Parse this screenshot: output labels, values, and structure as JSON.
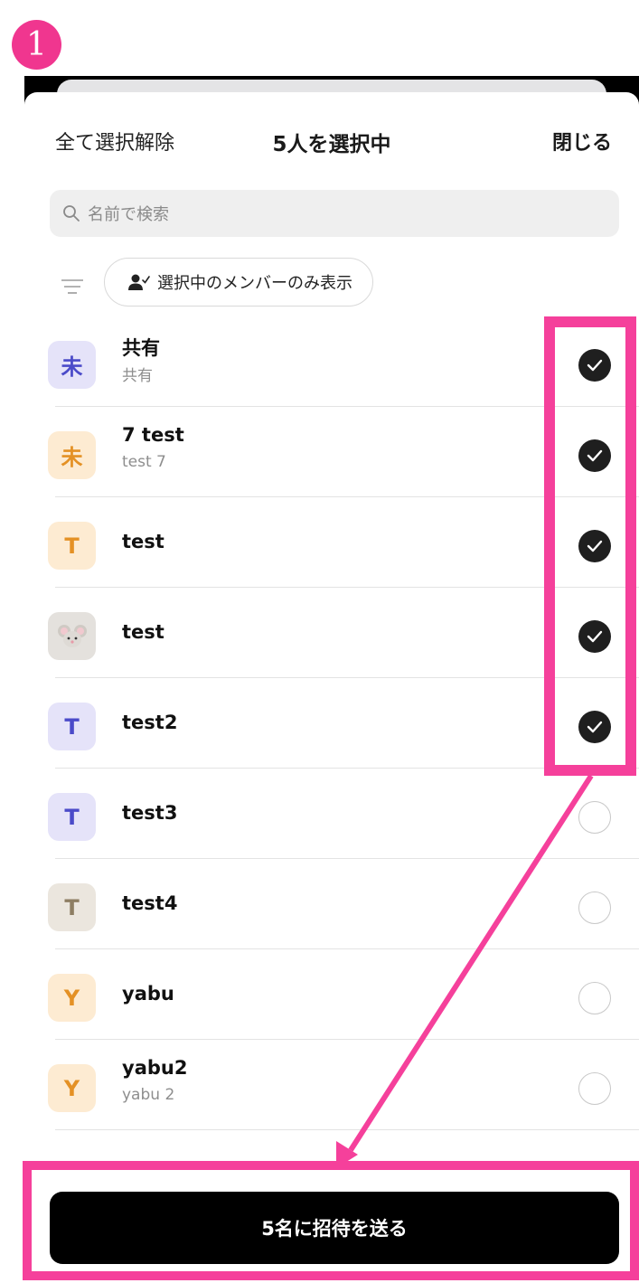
{
  "step_number": "1",
  "header": {
    "deselect_all": "全て選択解除",
    "title": "5人を選択中",
    "close": "閉じる"
  },
  "search": {
    "placeholder": "名前で検索"
  },
  "filter": {
    "chip_label": "選択中のメンバーのみ表示"
  },
  "members": [
    {
      "avatar": "未",
      "avatar_bg": "#e5e3f9",
      "avatar_fg": "#4b4bc9",
      "name": "共有",
      "sub": "共有",
      "selected": true
    },
    {
      "avatar": "未",
      "avatar_bg": "#fdebd2",
      "avatar_fg": "#e49125",
      "name": "7 test",
      "sub": "test 7",
      "selected": true
    },
    {
      "avatar": "T",
      "avatar_bg": "#fdebd2",
      "avatar_fg": "#e49125",
      "name": "test",
      "sub": "",
      "selected": true
    },
    {
      "avatar": "mouse-icon",
      "avatar_bg": "#e4e1dd",
      "avatar_fg": "#8a8580",
      "name": "test",
      "sub": "",
      "selected": true
    },
    {
      "avatar": "T",
      "avatar_bg": "#e5e3f9",
      "avatar_fg": "#4b4bc9",
      "name": "test2",
      "sub": "",
      "selected": true
    },
    {
      "avatar": "T",
      "avatar_bg": "#e5e3f9",
      "avatar_fg": "#4b4bc9",
      "name": "test3",
      "sub": "",
      "selected": false
    },
    {
      "avatar": "T",
      "avatar_bg": "#ebe6de",
      "avatar_fg": "#8e7e63",
      "name": "test4",
      "sub": "",
      "selected": false
    },
    {
      "avatar": "Y",
      "avatar_bg": "#fdebd2",
      "avatar_fg": "#e49125",
      "name": "yabu",
      "sub": "",
      "selected": false
    },
    {
      "avatar": "Y",
      "avatar_bg": "#fdebd2",
      "avatar_fg": "#e49125",
      "name": "yabu2",
      "sub": "yabu 2",
      "selected": false
    }
  ],
  "send_button": "5名に招待を送る",
  "colors": {
    "highlight": "#f5409b",
    "badge": "#f0368f"
  }
}
